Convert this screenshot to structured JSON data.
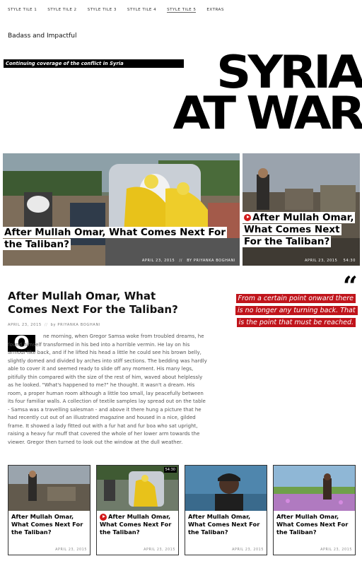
{
  "nav": {
    "items": [
      "STYLE TILE 1",
      "STYLE TILE 2",
      "STYLE TILE 3",
      "STYLE TILE 4",
      "STYLE TILE 5",
      "EXTRAS"
    ],
    "active_index": 4
  },
  "site_title": "Badass and Impactful",
  "coverage_banner": "Continuing coverage of the conflict in Syria",
  "headline": {
    "line1": "SYRIA",
    "line2": "AT WAR"
  },
  "hero": {
    "big": {
      "title": "After Mullah Omar, What Comes Next For the Taliban?",
      "date": "APRIL 23, 2015",
      "author": "BY PRIYANKA BOGHANI",
      "sep": "//"
    },
    "small": {
      "title": "After Mullah Omar, What Comes Next For the Taliban?",
      "date": "APRIL 23, 2015",
      "duration": "54:30",
      "icon": "play-icon"
    }
  },
  "article": {
    "title": "After Mullah Omar, What Comes Next For the Taliban?",
    "date": "APRIL 23, 2015",
    "sep": "//",
    "author": "by PRIYANKA BOGHANI",
    "dropcap": "O",
    "body": "ne morning, when Gregor Samsa woke from troubled dreams, he found himself transformed in his bed into a horrible vermin. He lay on his armour-like back, and if he lifted his head a little he could see his brown belly, slightly domed and divided by arches into stiff sections. The bedding was hardly able to cover it and seemed ready to slide off any moment. His many legs, pitifully thin compared with the size of the rest of him, waved about helplessly as he looked. \"What's happened to me?\" he thought. It wasn't a dream. His room, a proper human room although a little too small, lay peacefully between its four familiar walls. A collection of textile samples lay spread out on the table - Samsa was a travelling salesman - and above it there hung a picture that he had recently cut out of an illustrated magazine and housed in a nice, gilded frame. It showed a lady fitted out with a fur hat and fur boa who sat upright, raising a heavy fur muff that covered the whole of her lower arm towards the viewer. Gregor then turned to look out the window at the dull weather."
  },
  "pull_quote": {
    "mark": "“",
    "text": "From a certain point onward there is no longer any turning back. That is the point that must be reached."
  },
  "cards": [
    {
      "title": "After Mullah Omar, What Comes Next For the Taliban?",
      "date": "APRIL 23, 2015",
      "video": false
    },
    {
      "title": "After Mullah Omar, What Comes Next For the Taliban?",
      "date": "APRIL 23, 2015",
      "video": true,
      "duration": "54:30"
    },
    {
      "title": "After Mullah Omar, What Comes Next For the Taliban?",
      "date": "APRIL 23, 2015",
      "video": false
    },
    {
      "title": "After Mullah Omar, What Comes Next For the Taliban?",
      "date": "APRIL 23, 2015",
      "video": false
    }
  ],
  "colors": {
    "accent_red": "#c0141b",
    "black": "#000000",
    "text_gray": "#555555"
  }
}
